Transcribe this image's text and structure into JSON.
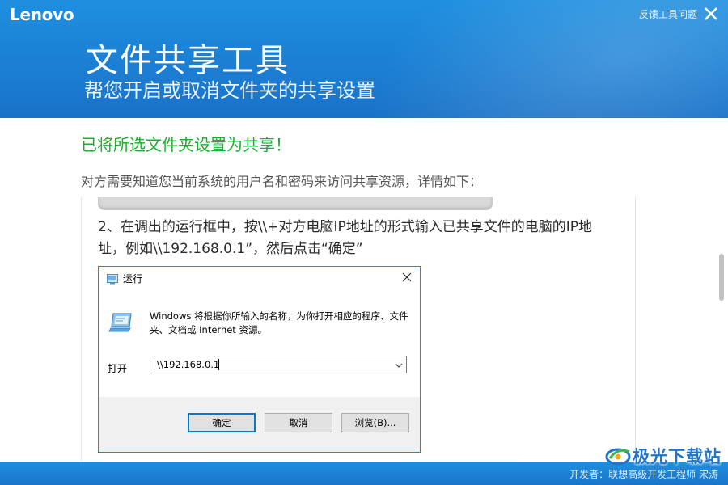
{
  "header": {
    "logo": "Lenovo",
    "feedback_label": "反馈工具问题",
    "title": "文件共享工具",
    "subtitle": "帮您开启或取消文件夹的共享设置"
  },
  "main": {
    "success_message": "已将所选文件夹设置为共享！",
    "description": "对方需要知道您当前系统的用户名和密码来访问共享资源，详情如下：",
    "step_text": "2、在调出的运行框中，按\\\\+对方电脑IP地址的形式输入已共享文件的电脑的IP地址，例如\\\\192.168.0.1”，然后点击“确定”"
  },
  "run_dialog": {
    "title": "运行",
    "description": "Windows 将根据你所输入的名称，为你打开相应的程序、文件夹、文档或 Internet 资源。",
    "open_label": "打开",
    "input_value": "\\\\192.168.0.1",
    "ok_label": "确定",
    "cancel_label": "取消",
    "browse_label": "浏览(B)..."
  },
  "footer": {
    "developer_text": "开发者：联想高级开发工程师 宋涛"
  },
  "watermark": {
    "text": "极光下载站",
    "url": "www.xz7.com"
  },
  "colors": {
    "header_blue": "#1b7fd4",
    "success_green": "#19b02d",
    "dialog_border": "#1e88e5"
  }
}
